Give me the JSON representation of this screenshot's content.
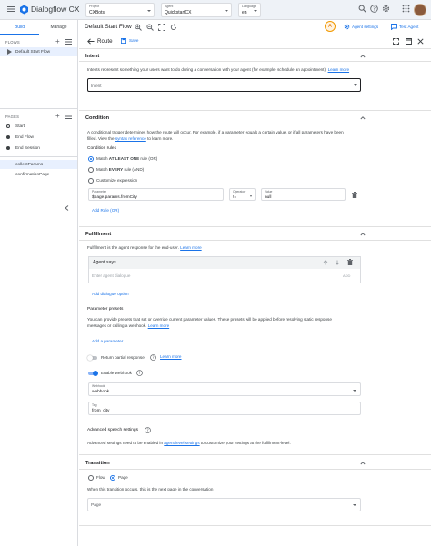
{
  "app": {
    "name": "Dialogflow CX"
  },
  "topbar": {
    "project": {
      "label": "Project",
      "value": "CXBots"
    },
    "agent": {
      "label": "Agent",
      "value": "QuickstartCX"
    },
    "language": {
      "label": "Language",
      "value": "en"
    }
  },
  "sidebar": {
    "tabs": [
      "Build",
      "Manage"
    ],
    "flows_header": "FLOWS",
    "flows": [
      "Default Start Flow"
    ],
    "pages_header": "PAGES",
    "pages": [
      "Start",
      "End Flow",
      "End Session"
    ],
    "custom_pages": [
      "collectParams",
      "confirmationPage"
    ]
  },
  "editor": {
    "title": "Default Start Flow",
    "badge": "A",
    "agent_settings": "Agent settings",
    "test_agent": "Test Agent"
  },
  "route": {
    "title": "Route",
    "save": "Save"
  },
  "intents": {
    "title": "Intent",
    "description": "Intents represent something your users want to do during a conversation with your agent (for example, schedule an appointment).",
    "learn_more": "Learn more",
    "field_placeholder": "Intent"
  },
  "condition": {
    "title": "Condition",
    "description_1": "A conditional trigger determines how the route will occur. For example, if a parameter equals a certain value, or if all parameters have been",
    "description_2": "filled. View the",
    "syntax_link": "syntax reference",
    "description_3": "to learn more.",
    "rules_label": "Condition rules",
    "options": [
      "Match AT LEAST ONE rule (OR)",
      "Match EVERY rule (AND)",
      "Customize expression"
    ],
    "selected_option": 0,
    "rule": {
      "parameter_label": "Parameter",
      "parameter_value": "$page.params.fromCity",
      "operator_label": "Operator",
      "operator_value": "!=",
      "value_label": "Value",
      "value_value": "null"
    },
    "add_rule": "Add Rule (OR)"
  },
  "fulfillment": {
    "title": "Fulfillment",
    "description": "Fulfillment is the agent response for the end-user.",
    "learn_more": "Learn more",
    "agent_says": "Agent says",
    "dialogue_placeholder": "Enter agent dialogue",
    "add_small": "ADD",
    "add_dialogue": "Add dialogue option",
    "presets_title": "Parameter presets",
    "presets_desc_1": "You can provide presets that set or override current parameter values. These presets will be applied before resolving static response",
    "presets_desc_2": "messages or calling a webhook.",
    "add_parameter": "Add a parameter",
    "partial_response": "Return partial response",
    "enable_webhook": "Enable webhook",
    "webhook_label": "Webhook",
    "webhook_value": "webhook",
    "tag_label": "Tag",
    "tag_value": "from_city"
  },
  "advanced": {
    "title": "Advanced speech settings",
    "desc_1": "Advanced settings need to be enabled in",
    "link": "agent level settings",
    "desc_2": "to customize your settings at the fulfillment-level."
  },
  "transition": {
    "title": "Transition",
    "options": [
      "Flow",
      "Page"
    ],
    "selected": 1,
    "description": "When this transition occurs, this is the next page in the conversation",
    "page_placeholder": "Page"
  },
  "colors": {
    "accent": "#1a73e8",
    "topbar": "#eef2f7",
    "selected": "#e8f0fe"
  }
}
